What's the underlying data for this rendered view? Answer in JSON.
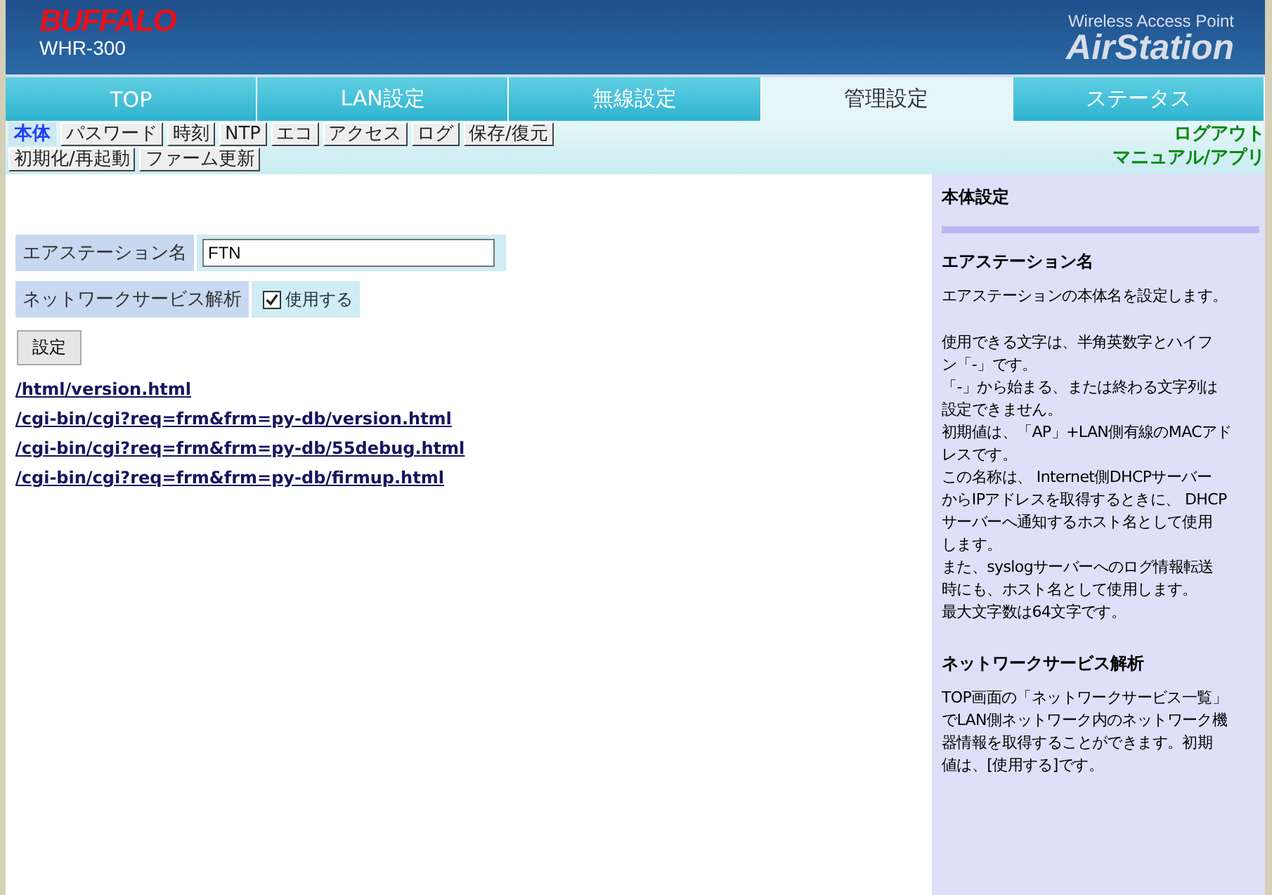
{
  "header": {
    "logo": "BUFFALO",
    "model": "WHR-300",
    "product_caption": "Wireless Access Point",
    "product_name": "AirStation"
  },
  "tabs": [
    {
      "label": "TOP",
      "selected": false
    },
    {
      "label": "LAN設定",
      "selected": false
    },
    {
      "label": "無線設定",
      "selected": false
    },
    {
      "label": "管理設定",
      "selected": true
    },
    {
      "label": "ステータス",
      "selected": false
    }
  ],
  "subtabs": [
    [
      {
        "label": "本体",
        "selected": true
      },
      {
        "label": "パスワード",
        "selected": false
      },
      {
        "label": "時刻",
        "selected": false
      },
      {
        "label": "NTP",
        "selected": false
      },
      {
        "label": "エコ",
        "selected": false
      },
      {
        "label": "アクセス",
        "selected": false
      },
      {
        "label": "ログ",
        "selected": false
      },
      {
        "label": "保存/復元",
        "selected": false
      }
    ],
    [
      {
        "label": "初期化/再起動",
        "selected": false
      },
      {
        "label": "ファーム更新",
        "selected": false
      }
    ]
  ],
  "top_links": [
    "ログアウト",
    "マニュアル/アプリ"
  ],
  "form": {
    "station_name": {
      "label": "エアステーション名",
      "value": "FTN"
    },
    "network_service": {
      "label": "ネットワークサービス解析",
      "option": "使用する",
      "checked": true
    },
    "submit": "設定"
  },
  "links": [
    "/html/version.html",
    "/cgi-bin/cgi?req=frm&frm=py-db/version.html",
    "/cgi-bin/cgi?req=frm&frm=py-db/55debug.html",
    "/cgi-bin/cgi?req=frm&frm=py-db/firmup.html"
  ],
  "help": {
    "title": "本体設定",
    "sections": [
      {
        "heading": "エアステーション名",
        "paragraphs": [
          [
            "エアステーションの本体名を設定します。"
          ],
          [
            "使用できる文字は、半角英数字とハイフ",
            "ン「-」です。",
            "「-」から始まる、または終わる文字列は",
            "設定できません。",
            "初期値は、「AP」+LAN側有線のMACアド",
            "レスです。",
            "この名称は、 Internet側DHCPサーバー",
            "からIPアドレスを取得するときに、 DHCP",
            "サーバーへ通知するホスト名として使用",
            "します。",
            "また、syslogサーバーへのログ情報転送",
            "時にも、ホスト名として使用します。",
            "最大文字数は64文字です。"
          ]
        ]
      },
      {
        "heading": "ネットワークサービス解析",
        "paragraphs": [
          [
            "TOP画面の「ネットワークサービス一覧」",
            "でLAN側ネットワーク内のネットワーク機",
            "器情報を取得することができます。初期",
            "値は、[使用する]です。"
          ]
        ]
      }
    ]
  }
}
